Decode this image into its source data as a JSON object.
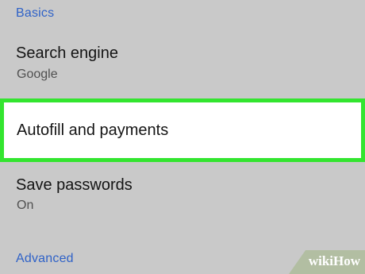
{
  "sections": {
    "basics": "Basics",
    "advanced": "Advanced"
  },
  "items": {
    "search_engine": {
      "title": "Search engine",
      "value": "Google"
    },
    "autofill": {
      "title": "Autofill and payments"
    },
    "save_passwords": {
      "title": "Save passwords",
      "value": "On"
    }
  },
  "watermark": {
    "brand": "wiki",
    "brand_suffix": "How"
  },
  "colors": {
    "background": "#c9c9c9",
    "section_header": "#2f62c8",
    "highlight_border": "#33e52f",
    "highlight_fill": "#ffffff"
  }
}
